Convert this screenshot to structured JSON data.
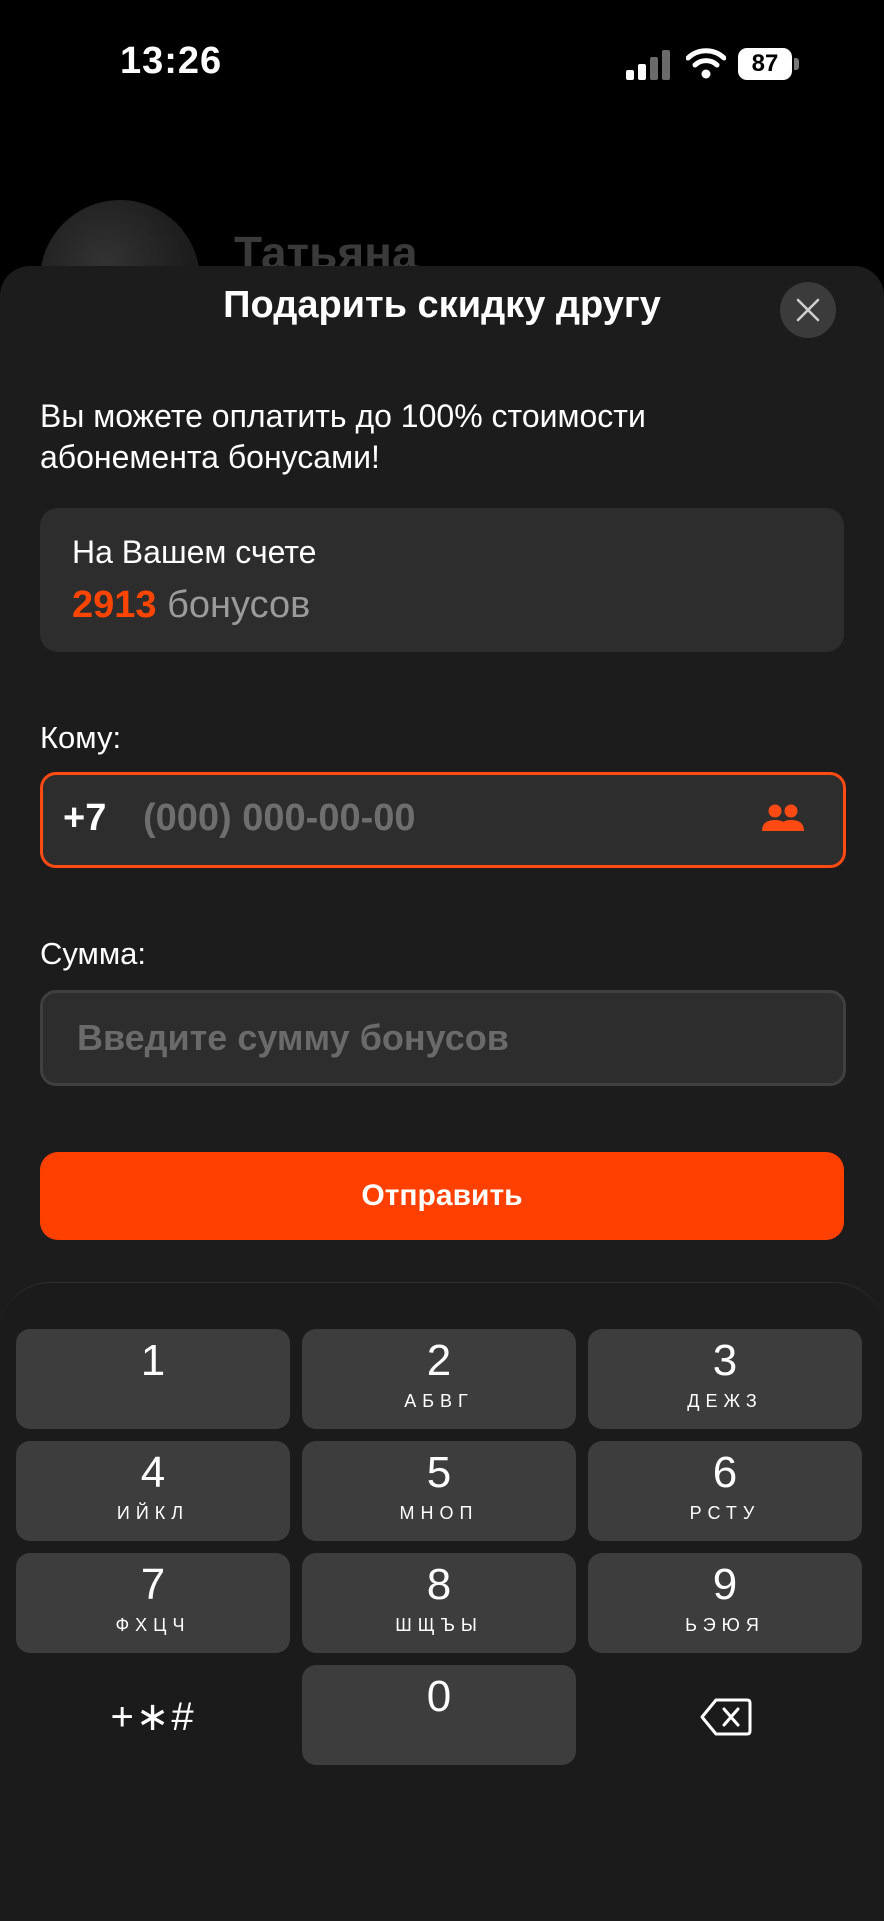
{
  "status_bar": {
    "time": "13:26",
    "battery": "87"
  },
  "background": {
    "name": "Татьяна"
  },
  "sheet": {
    "title": "Подарить скидку другу",
    "info": "Вы можете оплатить до 100% стоимости абонемента бонусами!",
    "balance": {
      "label": "На Вашем счете",
      "amount": "2913",
      "unit": "бонусов"
    },
    "recipient": {
      "label": "Кому:",
      "prefix": "+7",
      "placeholder": "(000) 000-00-00"
    },
    "sum": {
      "label": "Сумма:",
      "placeholder": "Введите сумму бонусов"
    },
    "send_label": "Отправить"
  },
  "keyboard": {
    "keys": [
      {
        "digit": "1",
        "letters": ""
      },
      {
        "digit": "2",
        "letters": "АБВГ"
      },
      {
        "digit": "3",
        "letters": "ДЕЖЗ"
      },
      {
        "digit": "4",
        "letters": "ИЙКЛ"
      },
      {
        "digit": "5",
        "letters": "МНОП"
      },
      {
        "digit": "6",
        "letters": "РСТУ"
      },
      {
        "digit": "7",
        "letters": "ФХЦЧ"
      },
      {
        "digit": "8",
        "letters": "ШЩЪЫ"
      },
      {
        "digit": "9",
        "letters": "ЬЭЮЯ"
      },
      {
        "digit": "0",
        "letters": ""
      }
    ],
    "symbols": "+∗#"
  },
  "colors": {
    "accent": "#ff4000",
    "sheet_bg": "#1c1c1c",
    "field_bg": "#2d2d2d"
  },
  "icons": [
    "close-icon",
    "contacts-icon",
    "backspace-icon",
    "signal-icon",
    "wifi-icon",
    "battery-icon"
  ]
}
